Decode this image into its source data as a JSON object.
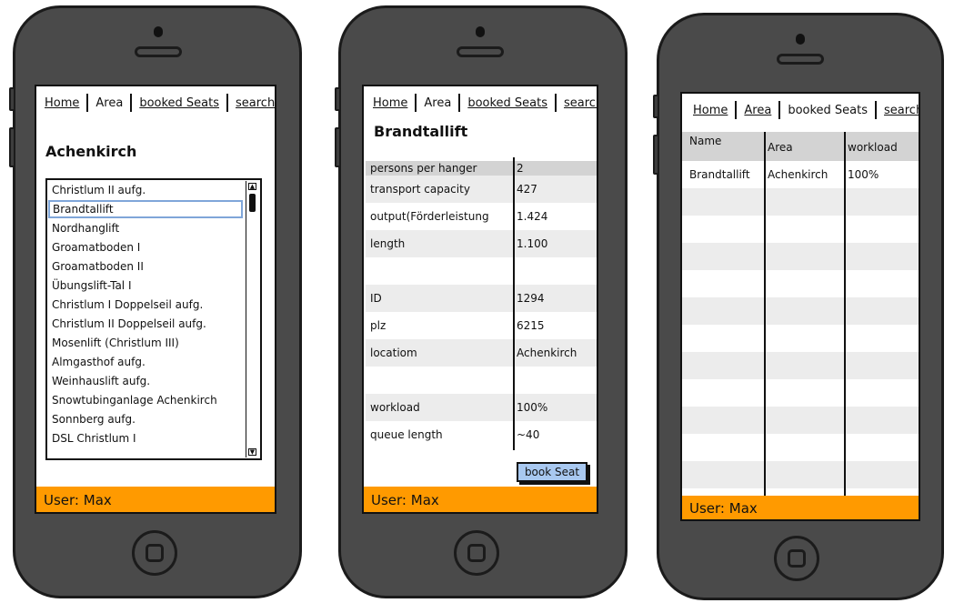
{
  "nav": {
    "home": "Home",
    "area": "Area",
    "booked": "booked Seats",
    "search": "search"
  },
  "footer": {
    "user": "User: Max"
  },
  "screen1": {
    "title": "Achenkirch",
    "items": [
      "Christlum II aufg.",
      "Brandtallift",
      "Nordhanglift",
      "Groamatboden I",
      "Groamatboden II",
      "Übungslift-Tal I",
      "Christlum I Doppelseil aufg.",
      "Christlum II Doppelseil aufg.",
      "Mosenlift (Christlum III)",
      "Almgasthof aufg.",
      "Weinhauslift aufg.",
      "Snowtubinganlage Achenkirch",
      "Sonnberg aufg.",
      "DSL Christlum I"
    ],
    "selected_index": 1
  },
  "screen2": {
    "title": "Brandtallift",
    "props": [
      {
        "k": "persons per hanger",
        "v": "2"
      },
      {
        "k": "transport capacity",
        "v": "427"
      },
      {
        "k": "output(Förderleistung",
        "v": "1.424"
      },
      {
        "k": "length",
        "v": "1.100"
      },
      {
        "k": "",
        "v": ""
      },
      {
        "k": "ID",
        "v": "1294"
      },
      {
        "k": "plz",
        "v": "6215"
      },
      {
        "k": "locatiom",
        "v": "Achenkirch"
      },
      {
        "k": "",
        "v": ""
      },
      {
        "k": "workload",
        "v": "100%"
      },
      {
        "k": "queue length",
        "v": "~40"
      }
    ],
    "book_button": "book Seat"
  },
  "screen3": {
    "columns": [
      "Name",
      "Area",
      "workload"
    ],
    "rows": [
      [
        "Brandtallift",
        "Achenkirch",
        "100%"
      ]
    ]
  },
  "colors": {
    "footer": "#ff9a00",
    "phone": "#4a4a4a",
    "button": "#a8c8f0",
    "header": "#d3d3d3"
  }
}
